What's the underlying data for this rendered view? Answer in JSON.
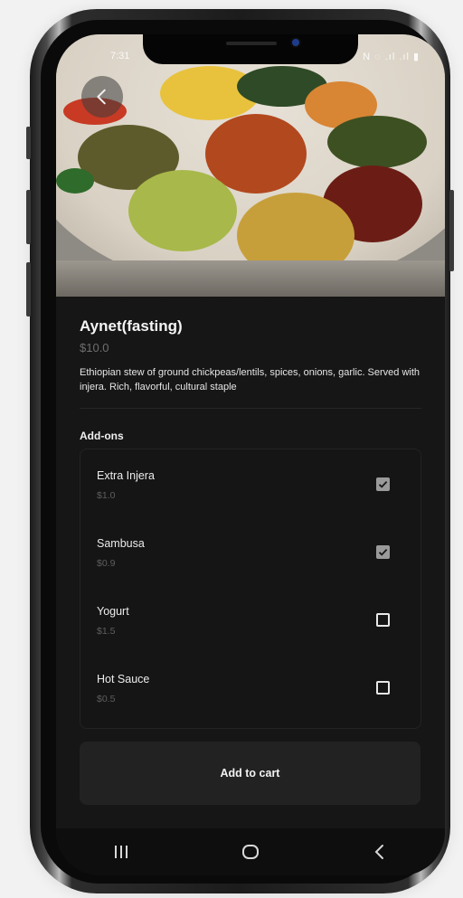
{
  "status_bar": {
    "time": "7:31",
    "signal": "N ◌ .ıl .ıl ▮"
  },
  "hero": {
    "image_alt": "Ethiopian platter"
  },
  "item": {
    "title": "Aynet(fasting)",
    "price": "$10.0",
    "description": "Ethiopian stew of ground chickpeas/lentils, spices, onions, garlic. Served with injera. Rich, flavorful, cultural staple"
  },
  "addons": {
    "title": "Add-ons",
    "items": [
      {
        "name": "Extra Injera",
        "price": "$1.0",
        "checked": true
      },
      {
        "name": "Sambusa",
        "price": "$0.9",
        "checked": true
      },
      {
        "name": "Yogurt",
        "price": "$1.5",
        "checked": false
      },
      {
        "name": "Hot Sauce",
        "price": "$0.5",
        "checked": false
      }
    ]
  },
  "cart": {
    "label": "Add to cart"
  },
  "nav": {
    "recents_icon": "recents-icon",
    "home_icon": "home-icon",
    "back_icon": "back-icon"
  },
  "colors": {
    "background": "#161616",
    "checked": "#9a9a9a",
    "text_muted": "#6e6e6e"
  }
}
